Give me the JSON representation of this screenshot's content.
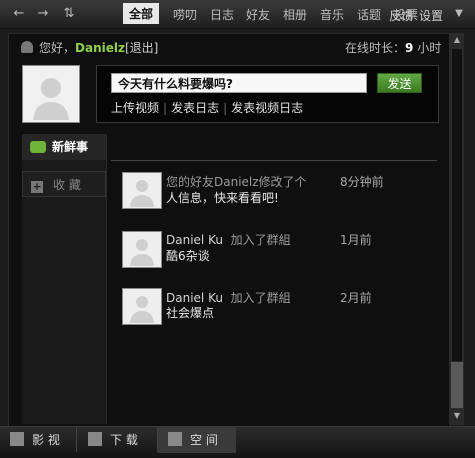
{
  "topbar": {
    "feedback": "反馈",
    "settings": "设置"
  },
  "greeting": {
    "hello": "您好，",
    "user": "Danielz",
    "logout": "[退出]"
  },
  "online": {
    "prefix": "在线时长：",
    "hours": "9",
    "suffix": "小时"
  },
  "status": {
    "placeholder": "今天有什么料要爆吗?",
    "button": "发送"
  },
  "actions": [
    "上传视频",
    "发表日志",
    "发表视频日志"
  ],
  "leftnav": {
    "fresh": "新鲜事",
    "favorites": "收 藏"
  },
  "tabs": [
    "全部",
    "唠叨",
    "日志",
    "好友",
    "相册",
    "音乐",
    "话题",
    "投票"
  ],
  "feed": [
    {
      "name": "您的好友Danielz修改了个",
      "line2": "人信息，快来看看吧!",
      "time": "8分钟前"
    },
    {
      "name": "Daniel Ku",
      "action": "加入了群組",
      "line2": "酷6杂谈",
      "time": "1月前"
    },
    {
      "name": "Daniel Ku",
      "action": "加入了群組",
      "line2": "社会爆点",
      "time": "2月前"
    }
  ],
  "bottom": {
    "video": "影 视",
    "download": "下 载",
    "space": "空 间"
  }
}
